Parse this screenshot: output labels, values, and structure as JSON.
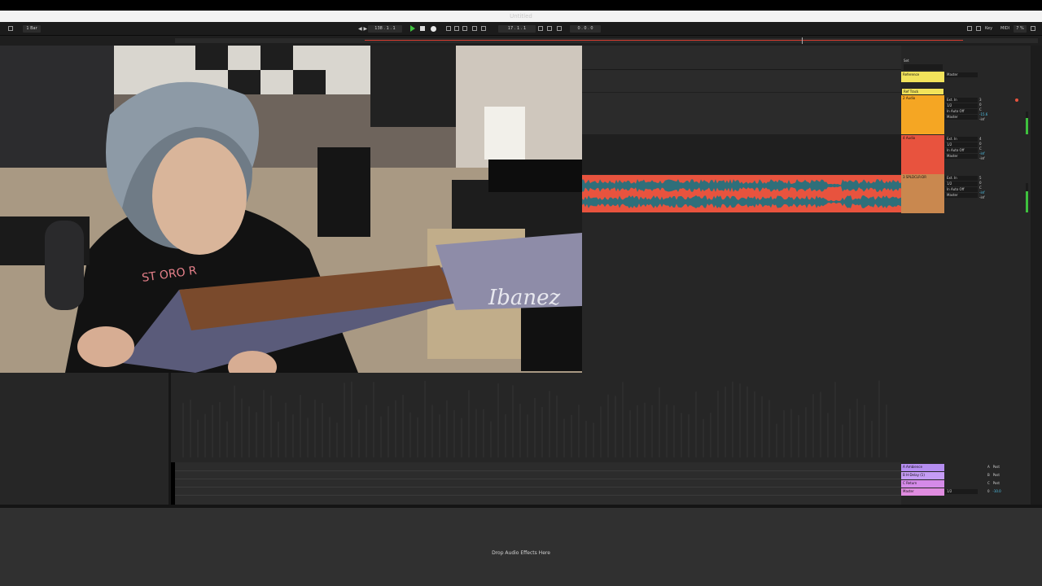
{
  "window": {
    "title": "Untitled"
  },
  "control_bar": {
    "quantize": "1 Bar",
    "tempo": "138 . 1 . 1",
    "position": "17 . 1 . 1",
    "loop_length": "0 . 0 . 0",
    "key_label": "Key",
    "midi_label": "MIDI",
    "cpu": "7 %"
  },
  "tracks": [
    {
      "name": "Reference",
      "color": "#f2e35b",
      "io": [
        "",
        ""
      ],
      "mix": [
        "Master"
      ]
    },
    {
      "name": "Ref Track",
      "color": "#f2e35b",
      "io": [],
      "mix": []
    },
    {
      "name": "2 Audio",
      "color": "#f5a623",
      "io": [
        "Ext. In",
        "1/2",
        "In Auto Off",
        "Master"
      ],
      "mix": [
        "3",
        "0",
        "C",
        "-15.6",
        "-inf"
      ]
    },
    {
      "name": "4 Audio",
      "color": "#e8533e",
      "io": [
        "Ext. In",
        "1/2",
        "In Auto Off",
        "Master"
      ],
      "mix": [
        "4",
        "0",
        "C",
        "-inf",
        "-inf"
      ]
    },
    {
      "name": "3 SPLDCLR-DR",
      "color": "#c9884f",
      "io": [
        "Ext. In",
        "1/2",
        "In Auto Off",
        "Master"
      ],
      "mix": [
        "5",
        "0",
        "C",
        "-inf",
        "-inf"
      ]
    }
  ],
  "returns": [
    {
      "name": "A Ambience",
      "color": "#b58df0",
      "mix": "A",
      "post": "Post"
    },
    {
      "name": "B H-Delay (1)",
      "color": "#c59cf5",
      "mix": "B",
      "post": "Post"
    },
    {
      "name": "C Return",
      "color": "#d58ae8",
      "mix": "C",
      "post": "Post"
    },
    {
      "name": "Master",
      "color": "#e08ce0",
      "mix": "0",
      "post": "-10.0"
    }
  ],
  "master_io": "1/2",
  "detail": {
    "drop_text": "Drop Audio Effects Here"
  },
  "webcam": {
    "brand_text": "Ibanez",
    "shirt_text": "ST ORO R"
  }
}
